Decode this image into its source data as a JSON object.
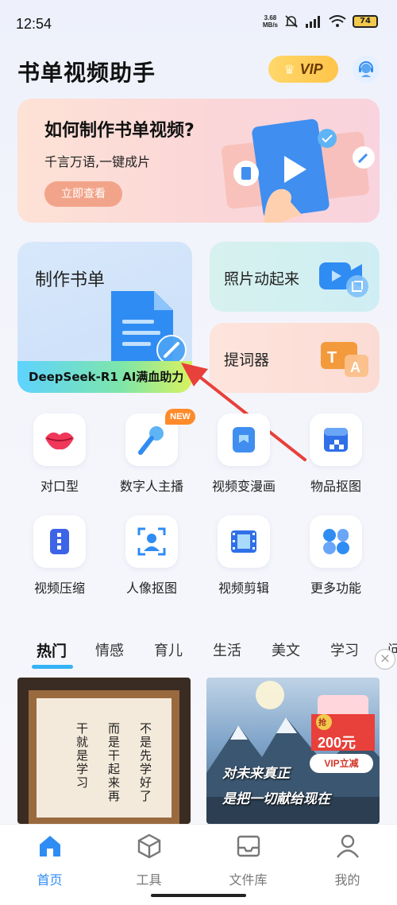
{
  "status_bar": {
    "time": "12:54",
    "net_speed_value": "3.68",
    "net_speed_unit": "MB/s",
    "battery": "74"
  },
  "header": {
    "title": "书单视频助手",
    "vip_label": "VIP"
  },
  "banner": {
    "title": "如何制作书单视频?",
    "subtitle": "千言万语,一键成片",
    "button": "立即查看"
  },
  "features": {
    "make_booklist": "制作书单",
    "ai_strip": "DeepSeek-R1 AI满血助力",
    "photo_animate": "照片动起来",
    "teleprompter": "提词器"
  },
  "tools": [
    {
      "label": "对口型",
      "icon": "lips-icon"
    },
    {
      "label": "数字人主播",
      "icon": "microphone-icon",
      "badge": "NEW"
    },
    {
      "label": "视频变漫画",
      "icon": "comic-icon"
    },
    {
      "label": "物品抠图",
      "icon": "box-cutout-icon"
    },
    {
      "label": "视频压缩",
      "icon": "compress-icon"
    },
    {
      "label": "人像抠图",
      "icon": "portrait-cutout-icon"
    },
    {
      "label": "视频剪辑",
      "icon": "film-edit-icon"
    },
    {
      "label": "更多功能",
      "icon": "more-grid-icon"
    }
  ],
  "category_tabs": [
    "热门",
    "情感",
    "育儿",
    "生活",
    "美文",
    "学习",
    "问"
  ],
  "content_cards": {
    "left_columns": [
      "不是先学好了",
      "而是干起来再",
      "干就是学习"
    ],
    "right_promo_amount": "200元",
    "right_promo_pill": "VIP立减",
    "right_promo_tag": "抢",
    "right_lines": [
      "对未来真正",
      "是把一切献给现在"
    ]
  },
  "bottom_nav": [
    {
      "label": "首页",
      "icon": "home-icon"
    },
    {
      "label": "工具",
      "icon": "tools-cube-icon"
    },
    {
      "label": "文件库",
      "icon": "inbox-icon"
    },
    {
      "label": "我的",
      "icon": "profile-icon"
    }
  ],
  "colors": {
    "accent_blue": "#2f8cf3",
    "tab_underline": "#36b3f5",
    "arrow_red": "#e8403a",
    "new_badge": "#ff8a2a"
  }
}
